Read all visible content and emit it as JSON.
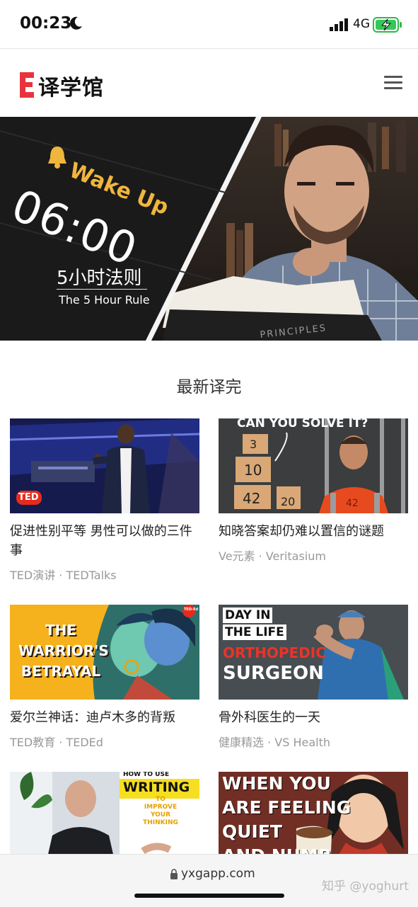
{
  "status_bar": {
    "time": "00:23",
    "network": "4G",
    "moon_icon": "moon-icon",
    "signal_icon": "signal-icon",
    "battery_icon": "battery-charging-icon"
  },
  "header": {
    "logo_mark": "E",
    "logo_text": "译学馆",
    "menu_icon": "hamburger-menu-icon",
    "accent": "#e8333c"
  },
  "hero": {
    "alarm_text": "Wake Up",
    "clock": "06:00",
    "title_cn": "5小时法则",
    "title_en": "The 5 Hour Rule",
    "book_text": "PRINCIPLES",
    "bell_icon": "bell-icon"
  },
  "section": {
    "title": "最新译完"
  },
  "cards": [
    {
      "title": "促进性别平等 男性可以做的三件事",
      "meta": "TED演讲 · TEDTalks",
      "badge": "TED"
    },
    {
      "title": "知晓答案却仍难以置信的谜题",
      "meta": "Ve元素 · Veritasium",
      "thumb_title": "CAN YOU SOLVE IT?",
      "boxes": [
        "3",
        "10",
        "42",
        "20"
      ],
      "jersey": "42"
    },
    {
      "title": "爱尔兰神话：迪卢木多的背叛",
      "meta": "TED教育 · TEDEd",
      "thumb_title": [
        "THE",
        "WARRIOR'S",
        "BETRAYAL"
      ],
      "badge": "TED-Ed"
    },
    {
      "title": "骨外科医生的一天",
      "meta": "健康精选 · VS Health",
      "thumb_title": [
        "DAY IN",
        "THE LIFE",
        "ORTHOPEDIC",
        "SURGEON"
      ]
    },
    {
      "thumb_title": [
        "HOW TO USE",
        "WRITING",
        "TO",
        "IMPROVE",
        "YOUR",
        "THINKING"
      ]
    },
    {
      "thumb_title": [
        "WHEN YOU",
        "ARE FEELING",
        "QUIET",
        "AND NUMB"
      ]
    }
  ],
  "url_bar": {
    "url": "yxgapp.com",
    "lock_icon": "lock-icon",
    "watermark": "知乎 @yoghurt"
  }
}
